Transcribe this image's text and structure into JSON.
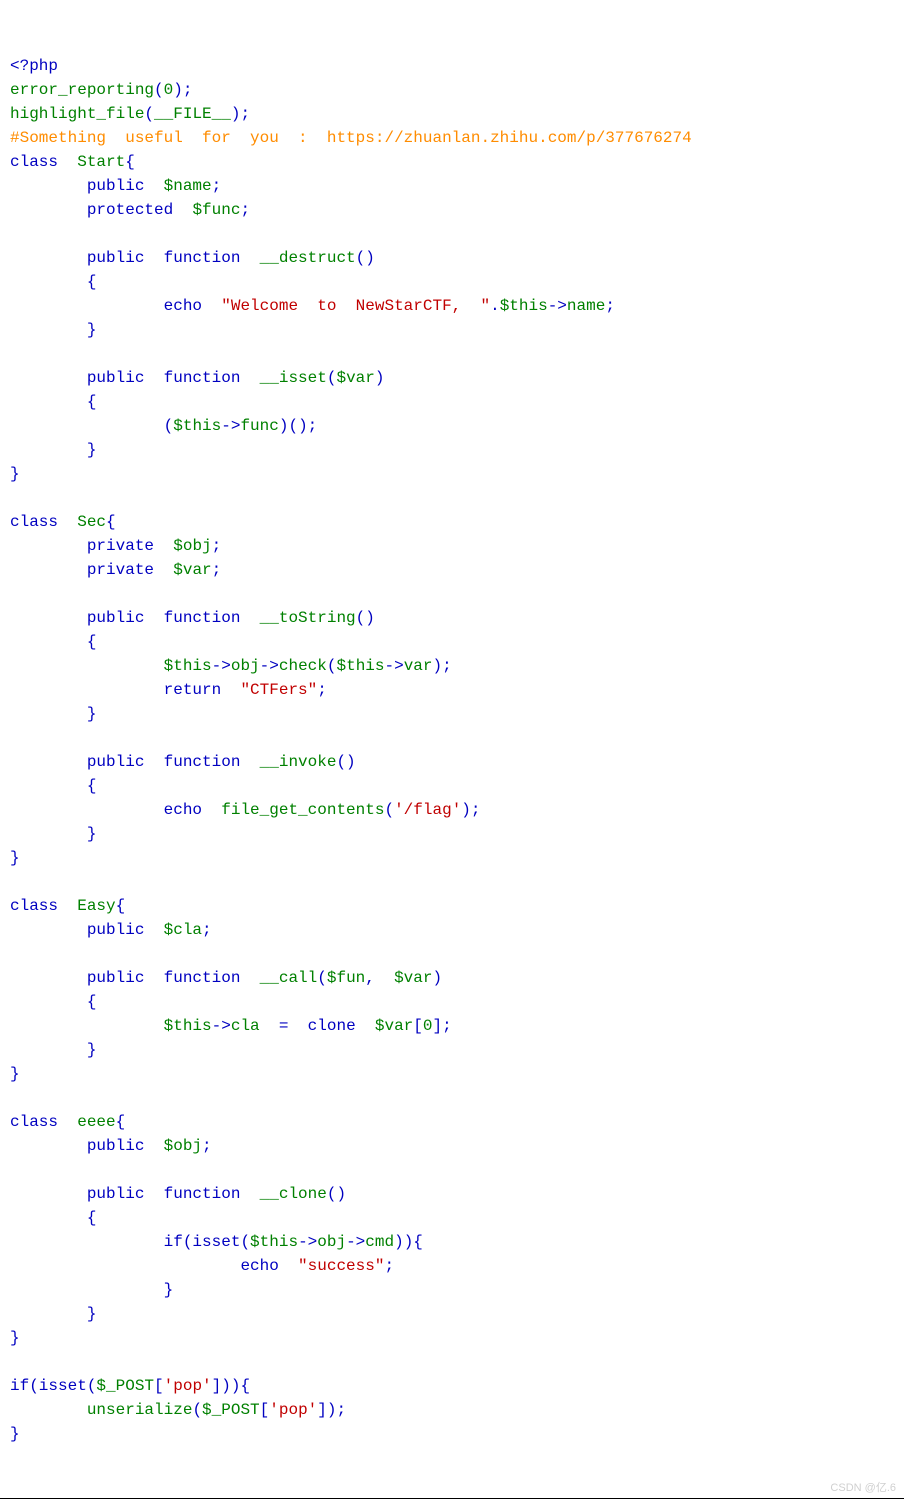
{
  "watermark": "CSDN @亿.6",
  "code": {
    "lines": [
      [
        [
          "blue",
          "<?php"
        ]
      ],
      [
        [
          "green",
          "error_reporting"
        ],
        [
          "blue",
          "("
        ],
        [
          "green",
          "0"
        ],
        [
          "blue",
          ");"
        ]
      ],
      [
        [
          "green",
          "highlight_file"
        ],
        [
          "blue",
          "("
        ],
        [
          "green",
          "__FILE__"
        ],
        [
          "blue",
          ");"
        ]
      ],
      [
        [
          "orange",
          "#Something useful for you : https://zhuanlan.zhihu.com/p/377676274"
        ]
      ],
      [
        [
          "blue",
          "class "
        ],
        [
          "green",
          "Start"
        ],
        [
          "blue",
          "{"
        ]
      ],
      [
        [
          "blue",
          "    public "
        ],
        [
          "green",
          "$name"
        ],
        [
          "blue",
          ";"
        ]
      ],
      [
        [
          "blue",
          "    protected "
        ],
        [
          "green",
          "$func"
        ],
        [
          "blue",
          ";"
        ]
      ],
      [
        [
          "blue",
          ""
        ]
      ],
      [
        [
          "blue",
          "    public function "
        ],
        [
          "green",
          "__destruct"
        ],
        [
          "blue",
          "()"
        ]
      ],
      [
        [
          "blue",
          "    {"
        ]
      ],
      [
        [
          "blue",
          "        echo "
        ],
        [
          "red",
          "\"Welcome to NewStarCTF, \""
        ],
        [
          "blue",
          "."
        ],
        [
          "green",
          "$this"
        ],
        [
          "blue",
          "->"
        ],
        [
          "green",
          "name"
        ],
        [
          "blue",
          ";"
        ]
      ],
      [
        [
          "blue",
          "    }"
        ]
      ],
      [
        [
          "blue",
          ""
        ]
      ],
      [
        [
          "blue",
          "    public function "
        ],
        [
          "green",
          "__isset"
        ],
        [
          "blue",
          "("
        ],
        [
          "green",
          "$var"
        ],
        [
          "blue",
          ")"
        ]
      ],
      [
        [
          "blue",
          "    {"
        ]
      ],
      [
        [
          "blue",
          "        ("
        ],
        [
          "green",
          "$this"
        ],
        [
          "blue",
          "->"
        ],
        [
          "green",
          "func"
        ],
        [
          "blue",
          ")();"
        ]
      ],
      [
        [
          "blue",
          "    }"
        ]
      ],
      [
        [
          "blue",
          "}"
        ]
      ],
      [
        [
          "blue",
          ""
        ]
      ],
      [
        [
          "blue",
          "class "
        ],
        [
          "green",
          "Sec"
        ],
        [
          "blue",
          "{"
        ]
      ],
      [
        [
          "blue",
          "    private "
        ],
        [
          "green",
          "$obj"
        ],
        [
          "blue",
          ";"
        ]
      ],
      [
        [
          "blue",
          "    private "
        ],
        [
          "green",
          "$var"
        ],
        [
          "blue",
          ";"
        ]
      ],
      [
        [
          "blue",
          ""
        ]
      ],
      [
        [
          "blue",
          "    public function "
        ],
        [
          "green",
          "__toString"
        ],
        [
          "blue",
          "()"
        ]
      ],
      [
        [
          "blue",
          "    {"
        ]
      ],
      [
        [
          "blue",
          "        "
        ],
        [
          "green",
          "$this"
        ],
        [
          "blue",
          "->"
        ],
        [
          "green",
          "obj"
        ],
        [
          "blue",
          "->"
        ],
        [
          "green",
          "check"
        ],
        [
          "blue",
          "("
        ],
        [
          "green",
          "$this"
        ],
        [
          "blue",
          "->"
        ],
        [
          "green",
          "var"
        ],
        [
          "blue",
          ");"
        ]
      ],
      [
        [
          "blue",
          "        return "
        ],
        [
          "red",
          "\"CTFers\""
        ],
        [
          "blue",
          ";"
        ]
      ],
      [
        [
          "blue",
          "    }"
        ]
      ],
      [
        [
          "blue",
          ""
        ]
      ],
      [
        [
          "blue",
          "    public function "
        ],
        [
          "green",
          "__invoke"
        ],
        [
          "blue",
          "()"
        ]
      ],
      [
        [
          "blue",
          "    {"
        ]
      ],
      [
        [
          "blue",
          "        echo "
        ],
        [
          "green",
          "file_get_contents"
        ],
        [
          "blue",
          "("
        ],
        [
          "red",
          "'/flag'"
        ],
        [
          "blue",
          ");"
        ]
      ],
      [
        [
          "blue",
          "    }"
        ]
      ],
      [
        [
          "blue",
          "}"
        ]
      ],
      [
        [
          "blue",
          ""
        ]
      ],
      [
        [
          "blue",
          "class "
        ],
        [
          "green",
          "Easy"
        ],
        [
          "blue",
          "{"
        ]
      ],
      [
        [
          "blue",
          "    public "
        ],
        [
          "green",
          "$cla"
        ],
        [
          "blue",
          ";"
        ]
      ],
      [
        [
          "blue",
          ""
        ]
      ],
      [
        [
          "blue",
          "    public function "
        ],
        [
          "green",
          "__call"
        ],
        [
          "blue",
          "("
        ],
        [
          "green",
          "$fun"
        ],
        [
          "blue",
          ", "
        ],
        [
          "green",
          "$var"
        ],
        [
          "blue",
          ")"
        ]
      ],
      [
        [
          "blue",
          "    {"
        ]
      ],
      [
        [
          "blue",
          "        "
        ],
        [
          "green",
          "$this"
        ],
        [
          "blue",
          "->"
        ],
        [
          "green",
          "cla"
        ],
        [
          "blue",
          " = clone "
        ],
        [
          "green",
          "$var"
        ],
        [
          "blue",
          "["
        ],
        [
          "green",
          "0"
        ],
        [
          "blue",
          "];"
        ]
      ],
      [
        [
          "blue",
          "    }"
        ]
      ],
      [
        [
          "blue",
          "}"
        ]
      ],
      [
        [
          "blue",
          ""
        ]
      ],
      [
        [
          "blue",
          "class "
        ],
        [
          "green",
          "eeee"
        ],
        [
          "blue",
          "{"
        ]
      ],
      [
        [
          "blue",
          "    public "
        ],
        [
          "green",
          "$obj"
        ],
        [
          "blue",
          ";"
        ]
      ],
      [
        [
          "blue",
          ""
        ]
      ],
      [
        [
          "blue",
          "    public function "
        ],
        [
          "green",
          "__clone"
        ],
        [
          "blue",
          "()"
        ]
      ],
      [
        [
          "blue",
          "    {"
        ]
      ],
      [
        [
          "blue",
          "        if(isset("
        ],
        [
          "green",
          "$this"
        ],
        [
          "blue",
          "->"
        ],
        [
          "green",
          "obj"
        ],
        [
          "blue",
          "->"
        ],
        [
          "green",
          "cmd"
        ],
        [
          "blue",
          ")){"
        ]
      ],
      [
        [
          "blue",
          "            echo "
        ],
        [
          "red",
          "\"success\""
        ],
        [
          "blue",
          ";"
        ]
      ],
      [
        [
          "blue",
          "        }"
        ]
      ],
      [
        [
          "blue",
          "    }"
        ]
      ],
      [
        [
          "blue",
          "}"
        ]
      ],
      [
        [
          "blue",
          ""
        ]
      ],
      [
        [
          "blue",
          "if(isset("
        ],
        [
          "green",
          "$_POST"
        ],
        [
          "blue",
          "["
        ],
        [
          "red",
          "'pop'"
        ],
        [
          "blue",
          "])){"
        ]
      ],
      [
        [
          "blue",
          "    "
        ],
        [
          "green",
          "unserialize"
        ],
        [
          "blue",
          "("
        ],
        [
          "green",
          "$_POST"
        ],
        [
          "blue",
          "["
        ],
        [
          "red",
          "'pop'"
        ],
        [
          "blue",
          "]);"
        ]
      ],
      [
        [
          "blue",
          "}"
        ]
      ]
    ]
  }
}
